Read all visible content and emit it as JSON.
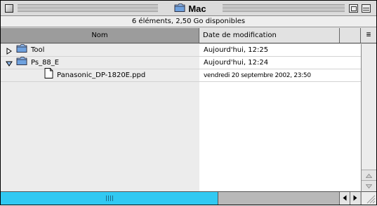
{
  "window": {
    "title": "Mac"
  },
  "info_bar": {
    "text": "6 éléments, 2,50 Go disponibles"
  },
  "columns": {
    "name": "Nom",
    "date": "Date de modification",
    "sort_indicator": "≣"
  },
  "rows": [
    {
      "name": "Tool",
      "date": "Aujourd'hui, 12:25",
      "kind": "folder",
      "expanded": false,
      "indent": 0
    },
    {
      "name": "Ps_88_E",
      "date": "Aujourd'hui, 12:24",
      "kind": "folder",
      "expanded": true,
      "indent": 0
    },
    {
      "name": "Panasonic_DP-1820E.ppd",
      "date": "vendredi 20 septembre 2002, 23:50",
      "kind": "document",
      "indent": 1
    }
  ],
  "colors": {
    "scroll_thumb": "#31c9f2",
    "sorted_column_header": "#9c9c9c"
  },
  "icons": {
    "window_title": "folder-icon",
    "disclosure_collapsed": "triangle-right-icon",
    "disclosure_expanded": "triangle-down-icon"
  }
}
